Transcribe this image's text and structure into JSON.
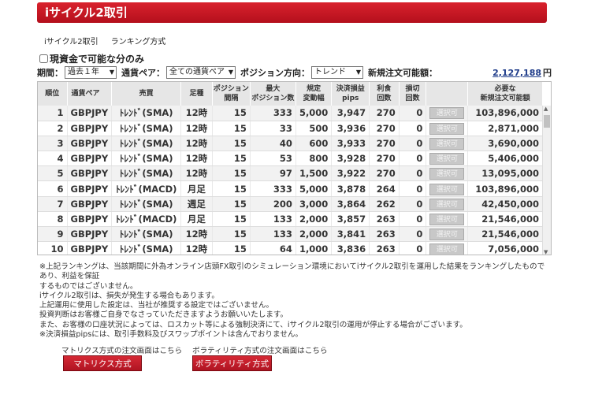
{
  "title": "iサイクル2取引",
  "tabs": [
    "iサイクル2取引",
    "ランキング方式"
  ],
  "checkbox_label": "現資金で可能な分のみ",
  "filters": {
    "period_label": "期間：",
    "period_value": "過去１年",
    "pair_label": "通貨ペア：",
    "pair_value": "全ての通貨ペア",
    "direction_label": "ポジション方向：",
    "direction_value": "トレンド",
    "available_label": "新規注文可能額：",
    "available_amount": "2,127,188",
    "available_unit": "円"
  },
  "table": {
    "headers": {
      "rank": "順位",
      "pair": "通貨ペア",
      "trade": "売買",
      "bar": "足種",
      "pos_interval_1": "ポジション",
      "pos_interval_2": "間隔",
      "max_pos_1": "最大",
      "max_pos_2": "ポジション数",
      "range_1": "規定",
      "range_2": "変動幅",
      "pl_1": "決済損益",
      "pl_2": "pips",
      "profit_1": "利食",
      "profit_2": "回数",
      "loss_1": "損切",
      "loss_2": "回数",
      "req_1": "必要な",
      "req_2": "新規注文可能額"
    },
    "select_label": "選択可",
    "rows": [
      {
        "rank": "1",
        "pair": "GBPJPY",
        "trade": "ﾄﾚﾝﾄﾞ(SMA)",
        "bar": "12時",
        "interval": "15",
        "max": "333",
        "range": "5,000",
        "pips": "3,947",
        "profit": "270",
        "loss": "0",
        "required": "103,896,000"
      },
      {
        "rank": "2",
        "pair": "GBPJPY",
        "trade": "ﾄﾚﾝﾄﾞ(SMA)",
        "bar": "12時",
        "interval": "15",
        "max": "33",
        "range": "500",
        "pips": "3,936",
        "profit": "270",
        "loss": "0",
        "required": "2,871,000"
      },
      {
        "rank": "3",
        "pair": "GBPJPY",
        "trade": "ﾄﾚﾝﾄﾞ(SMA)",
        "bar": "12時",
        "interval": "15",
        "max": "40",
        "range": "600",
        "pips": "3,933",
        "profit": "270",
        "loss": "0",
        "required": "3,690,000"
      },
      {
        "rank": "4",
        "pair": "GBPJPY",
        "trade": "ﾄﾚﾝﾄﾞ(SMA)",
        "bar": "12時",
        "interval": "15",
        "max": "53",
        "range": "800",
        "pips": "3,928",
        "profit": "270",
        "loss": "0",
        "required": "5,406,000"
      },
      {
        "rank": "5",
        "pair": "GBPJPY",
        "trade": "ﾄﾚﾝﾄﾞ(SMA)",
        "bar": "12時",
        "interval": "15",
        "max": "97",
        "range": "1,500",
        "pips": "3,922",
        "profit": "270",
        "loss": "0",
        "required": "13,095,000"
      },
      {
        "rank": "6",
        "pair": "GBPJPY",
        "trade": "ﾄﾚﾝﾄﾞ(MACD)",
        "bar": "月足",
        "interval": "15",
        "max": "333",
        "range": "5,000",
        "pips": "3,878",
        "profit": "264",
        "loss": "0",
        "required": "103,896,000"
      },
      {
        "rank": "7",
        "pair": "GBPJPY",
        "trade": "ﾄﾚﾝﾄﾞ(SMA)",
        "bar": "週足",
        "interval": "15",
        "max": "200",
        "range": "3,000",
        "pips": "3,864",
        "profit": "262",
        "loss": "0",
        "required": "42,450,000"
      },
      {
        "rank": "8",
        "pair": "GBPJPY",
        "trade": "ﾄﾚﾝﾄﾞ(MACD)",
        "bar": "月足",
        "interval": "15",
        "max": "133",
        "range": "2,000",
        "pips": "3,857",
        "profit": "263",
        "loss": "0",
        "required": "21,546,000"
      },
      {
        "rank": "9",
        "pair": "GBPJPY",
        "trade": "ﾄﾚﾝﾄﾞ(SMA)",
        "bar": "12時",
        "interval": "15",
        "max": "133",
        "range": "2,000",
        "pips": "3,841",
        "profit": "263",
        "loss": "0",
        "required": "21,546,000"
      },
      {
        "rank": "10",
        "pair": "GBPJPY",
        "trade": "ﾄﾚﾝﾄﾞ(SMA)",
        "bar": "12時",
        "interval": "15",
        "max": "64",
        "range": "1,000",
        "pips": "3,836",
        "profit": "263",
        "loss": "0",
        "required": "7,056,000"
      }
    ]
  },
  "notes": [
    "※上記ランキングは、当該期間に外為オンライン店頭FX取引のシミュレーション環境においてiサイクル2取引を運用した結果をランキングしたものであり、利益を保証",
    "するものではございません。",
    "iサイクル2取引は、損失が発生する場合もあります。",
    "上記運用に使用した設定は、当社が推奨する設定ではございません。",
    "投資判断はお客様ご自身でなさっていただきますようお願いいたします。",
    "また、お客様の口座状況によっては、ロスカット等による強制決済にて、iサイクル2取引の運用が停止する場合がございます。",
    "※決済損益pipsには、取引手数料及びスワップポイントは含んでおりません。"
  ],
  "bottom": {
    "matrix_text": "マトリクス方式の注文画面はこちら",
    "volatility_text": "ボラティリティ方式の注文画面はこちら",
    "matrix_button": "マトリクス方式",
    "volatility_button": "ボラティリティ方式"
  }
}
